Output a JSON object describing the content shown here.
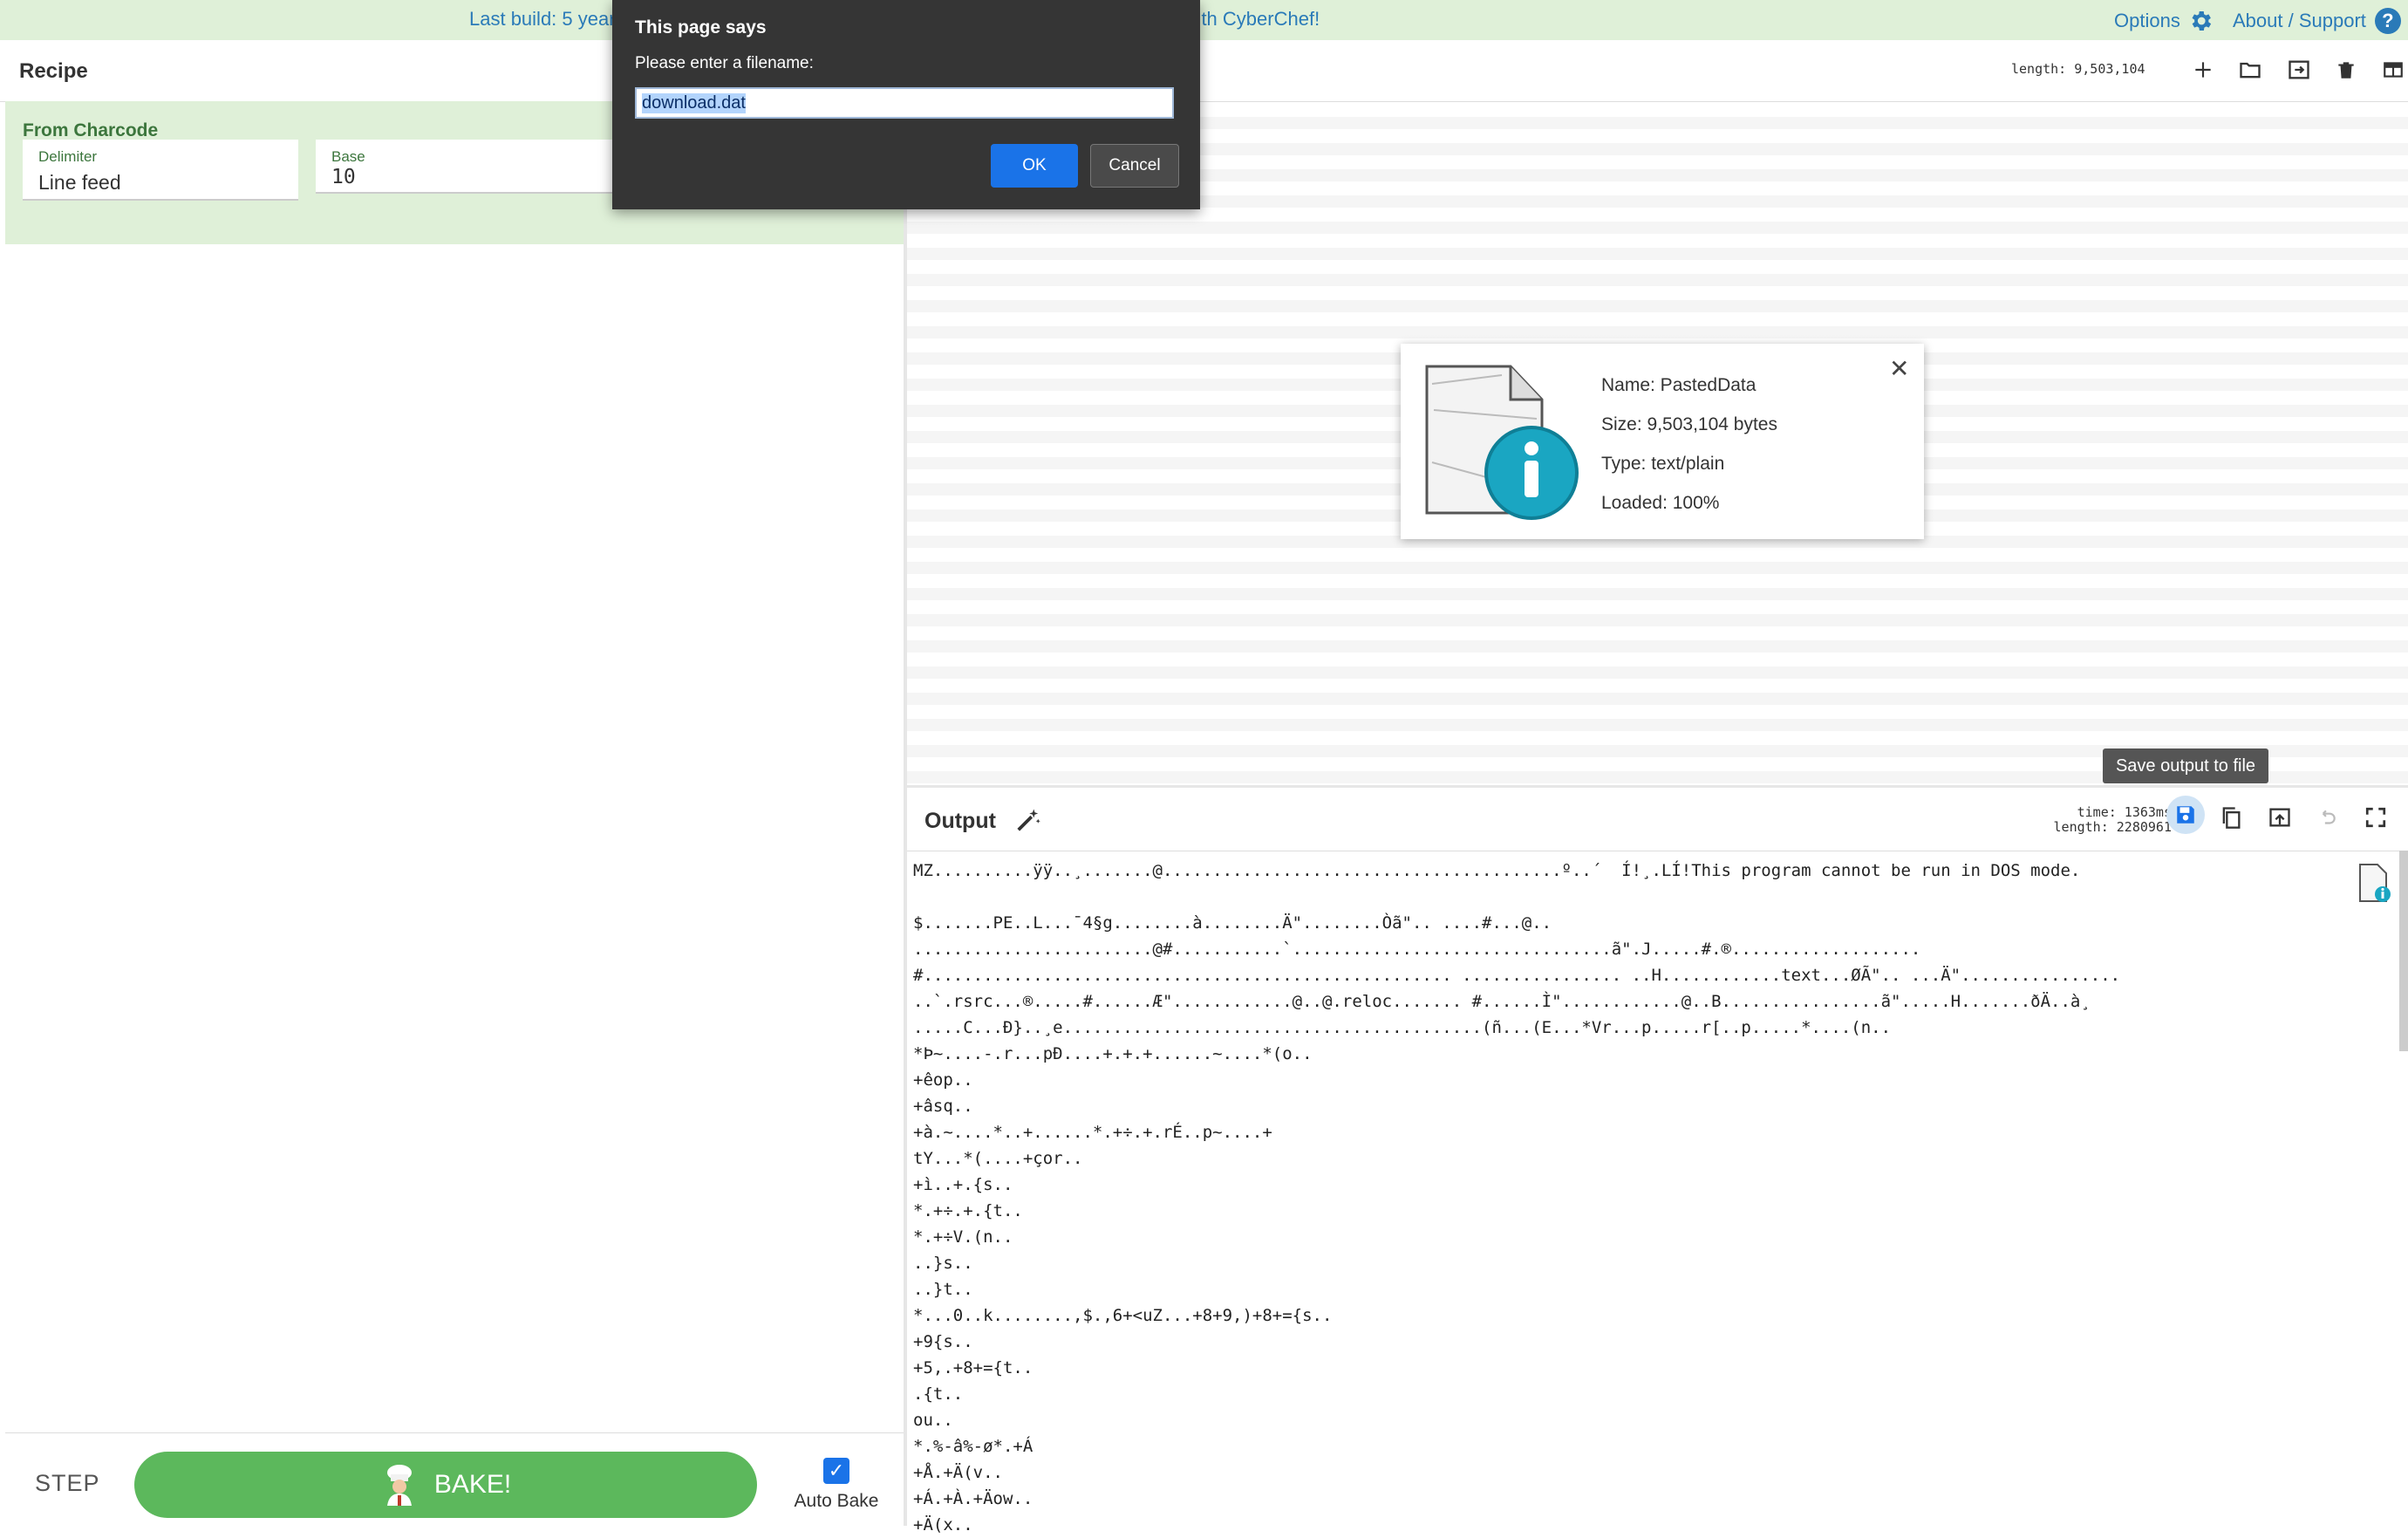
{
  "banner": {
    "left_text": "Last build: 5 years",
    "right_text": "am with CyberChef!",
    "options_label": "Options",
    "about_label": "About / Support",
    "options_icon": "gear-icon",
    "help_icon": "question-icon"
  },
  "recipe": {
    "title": "Recipe",
    "operation": {
      "name": "From Charcode",
      "delimiter_label": "Delimiter",
      "delimiter_value": "Line feed",
      "base_label": "Base",
      "base_value": "10"
    },
    "step_label": "STEP",
    "bake_label": "BAKE!",
    "auto_bake_label": "Auto Bake"
  },
  "input": {
    "length_text": "length: 9,503,104"
  },
  "file_info": {
    "name": "Name: PastedData",
    "size": "Size: 9,503,104 bytes",
    "type": "Type: text/plain",
    "loaded": "Loaded: 100%"
  },
  "output": {
    "title": "Output",
    "time_text": "time:  1363ms",
    "length_text": "length: 2280961",
    "tooltip": "Save output to file",
    "lines": [
      "MZ..........ÿÿ..¸.......@........................................º..´  Í!¸.LÍ!This program cannot be run in DOS mode.",
      "",
      "$.......PE..L...¯4§g........à........Ä\"........Òã\".. ....#...@..",
      "........................@#...........`................................ã\".J.....#.®...................",
      "#..................................................... ................ ..H............text...ØÃ\".. ...Ä\"................",
      "..`.rsrc...®.....#......Æ\"............@..@.reloc....... #......Ì\"............@..B................ã\".....H.......ðÄ..à¸",
      ".....C...Ð}..¸e..........................................(ñ...(E...*Vr...p.....r[..p.....*....(n..",
      "*Þ~....-.r...pÐ....+.+.+......~....*(o..",
      "+êop..",
      "+âsq..",
      "+à.~....*..+......*.+÷.+.rÉ..p~....+",
      "tY...*(....+çor..",
      "+ì..+.{s..",
      "*.+÷.+.{t..",
      "*.+÷V.(n..",
      "..}s..",
      "..}t..",
      "*...0..k........,$.,6+<uZ...+8+9,)+8+={s..",
      "+9{s..",
      "+5,.+8+={t..",
      ".{t..",
      "ou..",
      "*.%-â%-ø*.+Á",
      "+Å.+Ä(v..",
      "+Á.+À.+Äow..",
      "+Ä(x.."
    ]
  },
  "dialog": {
    "title": "This page says",
    "message": "Please enter a filename:",
    "filename_value": "download.dat",
    "ok_label": "OK",
    "cancel_label": "Cancel"
  }
}
